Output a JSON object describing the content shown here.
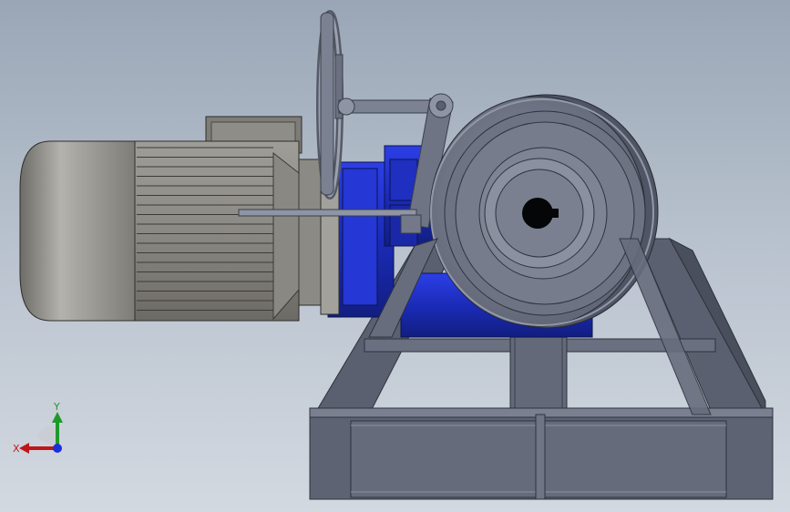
{
  "viewport": {
    "background_top": "#9aa6b6",
    "background_bottom": "#d3d9e1"
  },
  "model": {
    "parts": [
      "electric-motor",
      "gear-reducer",
      "handwheel",
      "drum-pulley",
      "base-frame",
      "control-rod"
    ],
    "colors": {
      "motor": "#8e8c86",
      "reducer": "#1b2fcf",
      "steel": "#6f7585",
      "frame": "#5d6373"
    }
  },
  "triad": {
    "x_label": "X",
    "y_label": "Y",
    "x_color": "#c0161b",
    "y_color": "#1f9a2a",
    "z_color": "#1a2fd8"
  }
}
